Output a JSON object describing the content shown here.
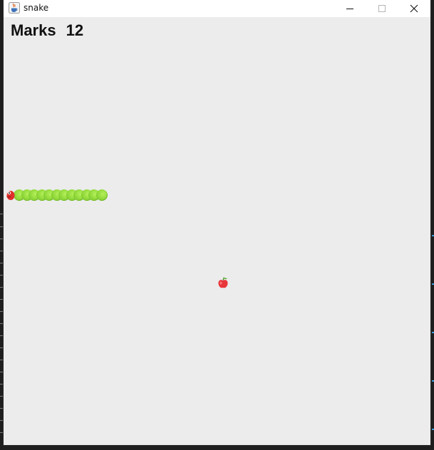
{
  "window": {
    "title": "snake",
    "app_icon": "java-cup-icon",
    "controls": [
      "minimize-icon",
      "maximize-icon",
      "close-icon"
    ]
  },
  "game": {
    "score_label": "Marks",
    "score_value": "12",
    "snake_body_segments": 12,
    "head_color": "#e0302c",
    "body_color": "#8fd83a",
    "apple_color": "#e8363a",
    "background": "#ececec"
  }
}
